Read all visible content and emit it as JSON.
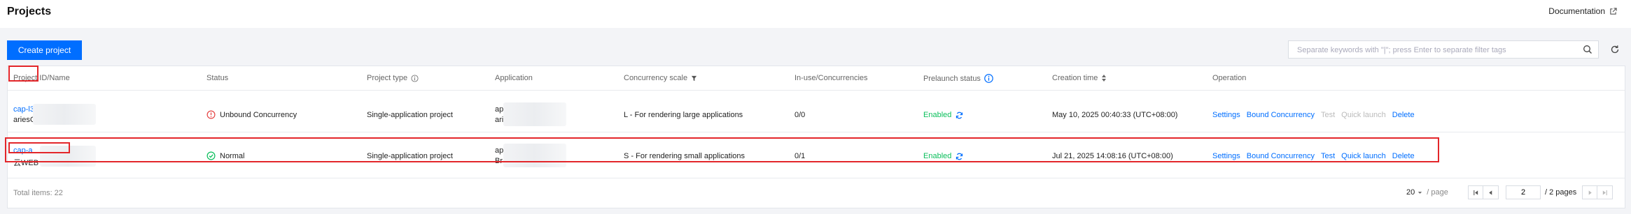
{
  "header": {
    "title": "Projects",
    "documentation": "Documentation"
  },
  "toolbar": {
    "create_label": "Create project",
    "search_placeholder": "Separate keywords with \"|\"; press Enter to separate filter tags"
  },
  "table": {
    "columns": {
      "project_id_name": "Project ID/Name",
      "status": "Status",
      "project_type": "Project type",
      "application": "Application",
      "concurrency_scale": "Concurrency scale",
      "in_use": "In-use/Concurrencies",
      "prelaunch": "Prelaunch status",
      "creation_time": "Creation time",
      "operation": "Operation"
    },
    "rows": [
      {
        "project_id": "cap-l3",
        "project_name": "ariesG",
        "status": "Unbound Concurrency",
        "status_color": "#e54545",
        "project_type": "Single-application project",
        "app_line1": "ap",
        "app_line2": "ari",
        "concurrency": "L - For rendering large applications",
        "in_use": "0/0",
        "prelaunch": "Enabled",
        "created": "May 10, 2025 00:40:33 (UTC+08:00)",
        "ops": {
          "settings": "Settings",
          "bound": "Bound Concurrency",
          "test": "Test",
          "quick": "Quick launch",
          "delete": "Delete"
        }
      },
      {
        "project_id": "cap-a",
        "project_name": "云WEB",
        "status": "Normal",
        "status_color": "#0abf5b",
        "project_type": "Single-application project",
        "app_line1": "ap",
        "app_line2": "Br",
        "concurrency": "S - For rendering small applications",
        "in_use": "0/1",
        "prelaunch": "Enabled",
        "created": "Jul 21, 2025 14:08:16 (UTC+08:00)",
        "ops": {
          "settings": "Settings",
          "bound": "Bound Concurrency",
          "test": "Test",
          "quick": "Quick launch",
          "delete": "Delete"
        }
      }
    ]
  },
  "footer": {
    "total": "Total items:  22",
    "page_size": "20",
    "page_size_unit": "/ page",
    "current_page": "2",
    "total_pages": "/ 2 pages"
  },
  "colors": {
    "accent": "#006eff",
    "success": "#0abf5b",
    "error": "#e54545",
    "highlight": "#e3262a"
  }
}
